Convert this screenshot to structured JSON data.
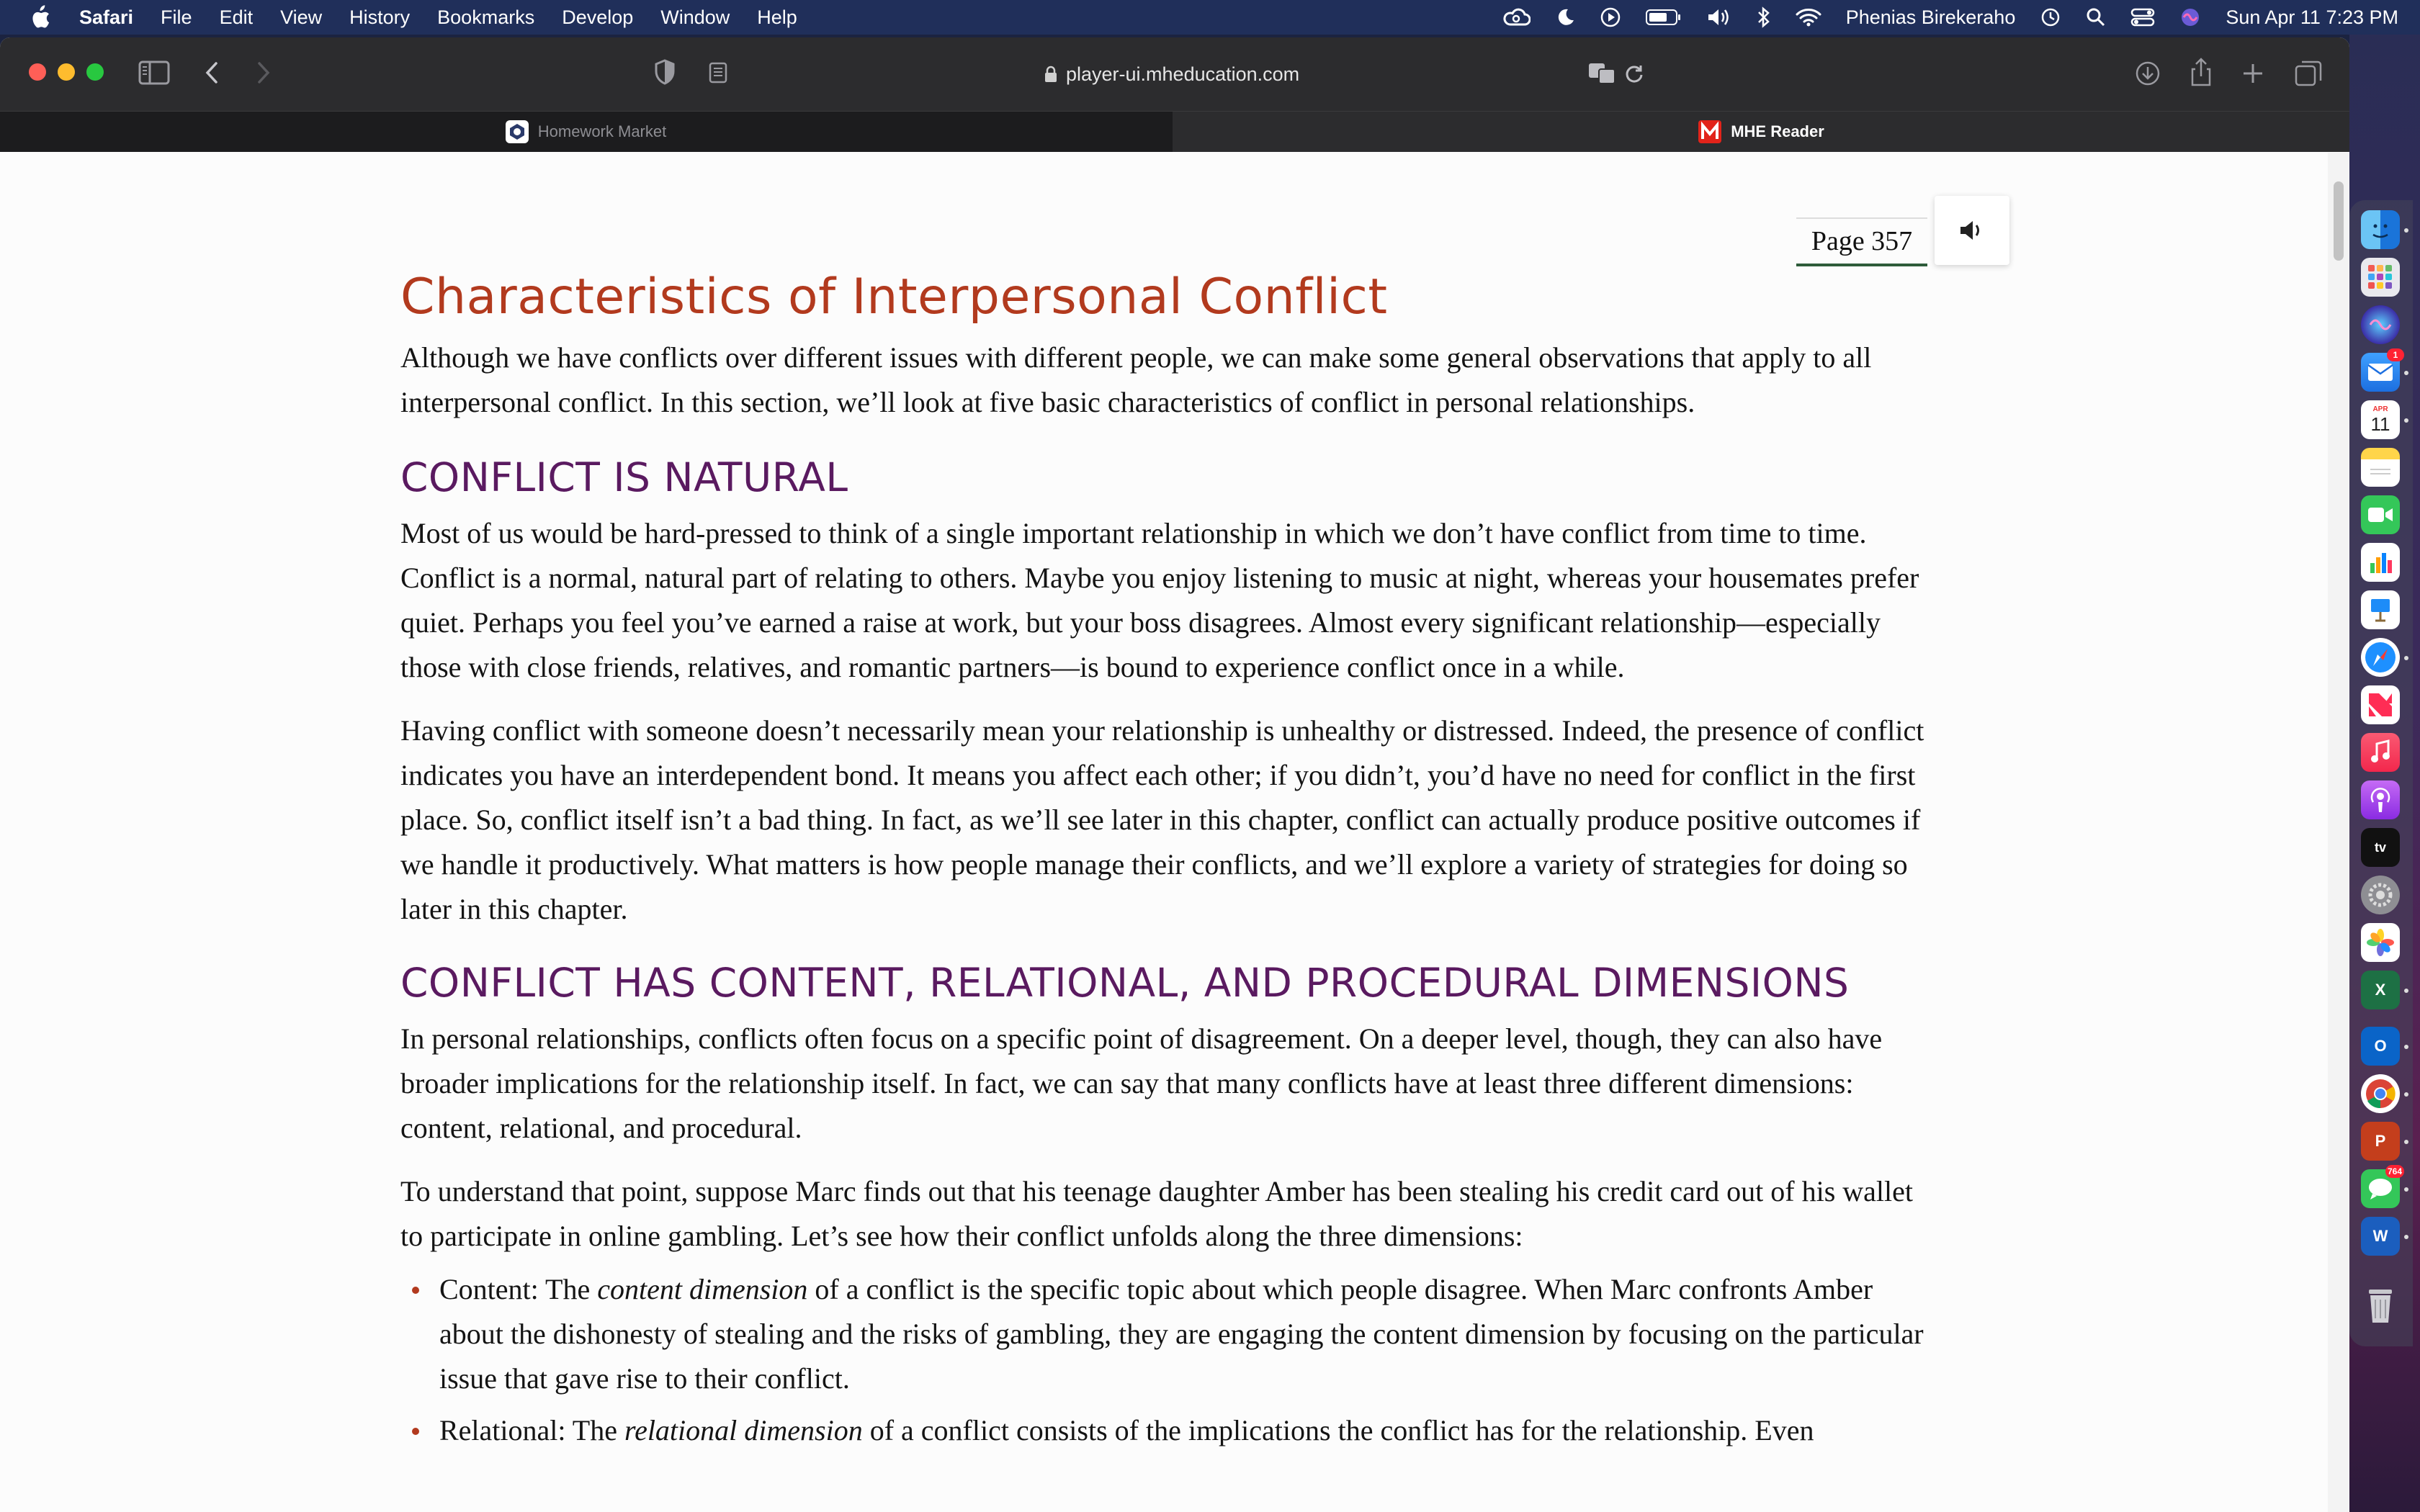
{
  "menubar": {
    "app_name": "Safari",
    "menus": [
      "File",
      "Edit",
      "View",
      "History",
      "Bookmarks",
      "Develop",
      "Window",
      "Help"
    ],
    "user_name": "Phenias Birekeraho",
    "datetime": "Sun Apr 11  7:23 PM",
    "status_icons": [
      "creative-cloud-icon",
      "moon-icon",
      "play-icon",
      "battery-icon",
      "volume-icon",
      "bluetooth-icon",
      "wifi-icon",
      "time-machine-icon",
      "search-icon",
      "control-center-icon",
      "siri-icon"
    ]
  },
  "browser": {
    "url": "player-ui.mheducation.com",
    "tabs": [
      {
        "label": "Homework Market",
        "active": false
      },
      {
        "label": "MHE Reader",
        "active": true
      }
    ]
  },
  "reader": {
    "page_label": "Page 357",
    "title": "Characteristics of Interpersonal Conflict",
    "intro": "Although we have conflicts over different issues with different people, we can make some general observations that apply to all interpersonal conflict. In this section, we’ll look at five basic characteristics of conflict in personal relationships.",
    "section1": {
      "heading": "CONFLICT IS NATURAL",
      "p1": "Most of us would be hard-pressed to think of a single important relationship in which we don’t have conflict from time to time. Conflict is a normal, natural part of relating to others. Maybe you enjoy listening to music at night, whereas your housemates prefer quiet. Perhaps you feel you’ve earned a raise at work, but your boss disagrees. Almost every significant relationship—especially those with close friends, relatives, and romantic partners—is bound to experience conflict once in a while.",
      "p2": "Having conflict with someone doesn’t necessarily mean your relationship is unhealthy or distressed. Indeed, the presence of conflict indicates you have an interdependent bond. It means you affect each other; if you didn’t, you’d have no need for conflict in the first place. So, conflict itself isn’t a bad thing. In fact, as we’ll see later in this chapter, conflict can actually produce positive outcomes if we handle it productively. What matters is how people manage their conflicts, and we’ll explore a variety of strategies for doing so later in this chapter."
    },
    "section2": {
      "heading": "CONFLICT HAS CONTENT, RELATIONAL, AND PROCEDURAL DIMENSIONS",
      "p1": "In personal relationships, conflicts often focus on a specific point of disagreement. On a deeper level, though, they can also have broader implications for the relationship itself. In fact, we can say that many conflicts have at least three different dimensions: content, relational, and procedural.",
      "p2": "To understand that point, suppose Marc finds out that his teenage daughter Amber has been stealing his credit card out of his wallet to participate in online gambling. Let’s see how their conflict unfolds along the three dimensions:",
      "bullets": [
        {
          "lead": "Content: The ",
          "term": "content dimension",
          "rest": " of a conflict is the specific topic about which people disagree. When Marc confronts Amber about the dishonesty of stealing and the risks of gambling, they are engaging the content dimension by focusing on the particular issue that gave rise to their conflict."
        },
        {
          "lead": "Relational: The ",
          "term": "relational dimension",
          "rest": " of a conflict consists of the implications the conflict has for the relationship. Even"
        }
      ]
    }
  },
  "dock": {
    "calendar_month": "APR",
    "calendar_day": "11",
    "mail_badge": "1",
    "messages_badge": "764",
    "excel_letter": "X",
    "outlook_letter": "O",
    "powerpoint_letter": "P",
    "word_letter": "W",
    "appletv_label": "tv"
  },
  "colors": {
    "title": "#b23a1e",
    "heading": "#5a1a60",
    "page_rule": "#2e5c3a",
    "menubar": "#202f5a"
  }
}
